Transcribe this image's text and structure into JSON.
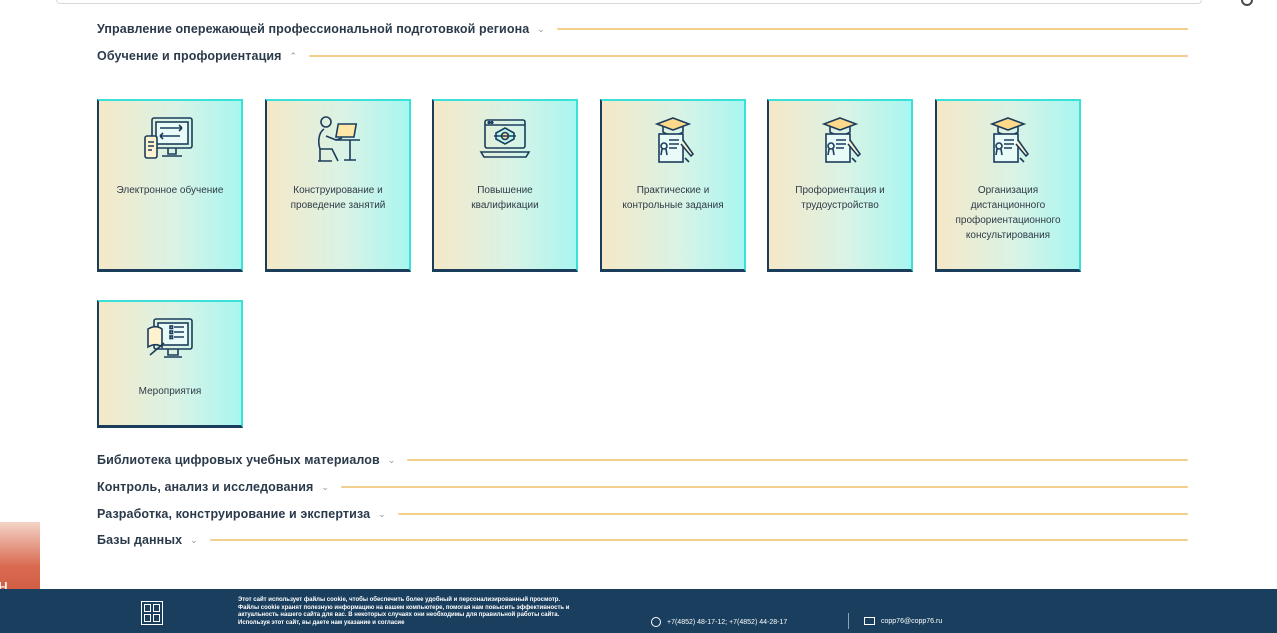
{
  "sections_top": [
    {
      "title": "Управление опережающей профессиональной подготовкой региона",
      "chevron": "⌄"
    },
    {
      "title": "Обучение и профориентация",
      "chevron": "⌃"
    }
  ],
  "tiles": [
    {
      "label": "Электронное обучение",
      "icon": "computer-elearning-icon"
    },
    {
      "label": "Конструирование и проведение занятий",
      "icon": "person-at-laptop-icon"
    },
    {
      "label": "Повышение квалификации",
      "icon": "laptop-certificate-icon"
    },
    {
      "label": "Практические и контрольные задания",
      "icon": "graduation-diploma-icon"
    },
    {
      "label": "Профориентация и трудоустройство",
      "icon": "graduation-diploma-icon"
    },
    {
      "label": "Организация дистанционного профориентационного консультирования",
      "icon": "graduation-diploma-icon"
    },
    {
      "label": "Мероприятия",
      "icon": "computer-book-checklist-icon"
    }
  ],
  "sections_bottom": [
    {
      "title": "Библиотека цифровых учебных материалов",
      "chevron": "⌄"
    },
    {
      "title": "Контроль, анализ и исследования",
      "chevron": "⌄"
    },
    {
      "title": "Разработка, конструирование и экспертиза",
      "chevron": "⌄"
    },
    {
      "title": "Базы данных",
      "chevron": "⌄"
    }
  ],
  "footer": {
    "cookie_text": "Этот сайт использует файлы cookie, чтобы обеспечить более удобный и персонализированный просмотр. Файлы cookie хранят полезную информацию на вашем компьютере, помогая нам повысить эффективность и актуальность нашего сайта для вас. В некоторых случаях они необходимы для правильной работы сайта. Используя этот сайт, вы даете нам указание и согласие",
    "phone": "+7(4852) 48-17-12; +7(4852) 44-28-17",
    "email": "copp76@copp76.ru"
  },
  "left_fragment": "н\nа",
  "colors": {
    "accent_line": "#f2cf8c",
    "tile_border": "#3be0d8",
    "footer_bg": "#1a3f5e"
  }
}
